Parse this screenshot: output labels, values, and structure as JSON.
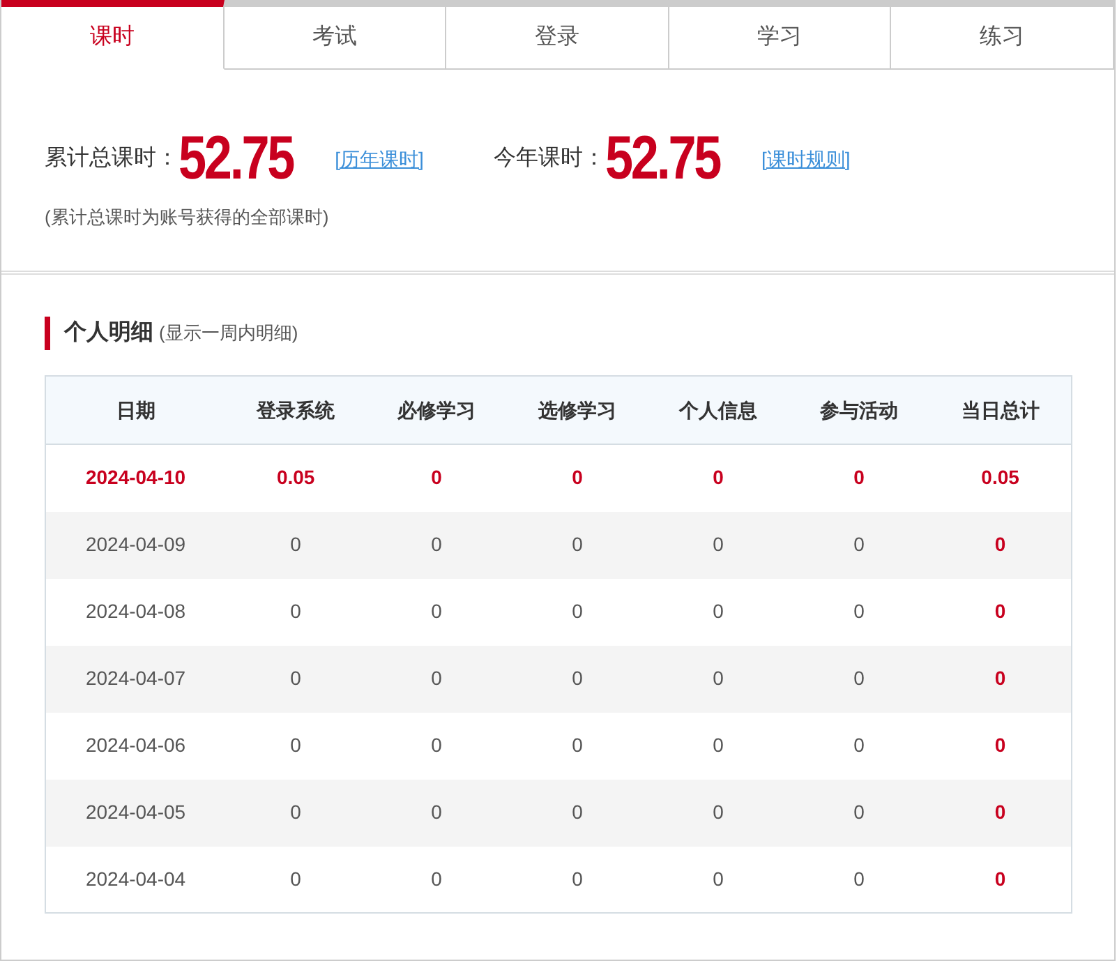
{
  "tabs": [
    {
      "label": "课时",
      "selected": true
    },
    {
      "label": "考试",
      "selected": false
    },
    {
      "label": "登录",
      "selected": false
    },
    {
      "label": "学习",
      "selected": false
    },
    {
      "label": "练习",
      "selected": false
    }
  ],
  "summary": {
    "stats": [
      {
        "label": "累计总课时：",
        "value": "52.75",
        "link": "[历年课时]"
      },
      {
        "label": "今年课时：",
        "value": "52.75",
        "link": "[课时规则]"
      }
    ],
    "note": "(累计总课时为账号获得的全部课时)"
  },
  "detail": {
    "title": "个人明细",
    "subtitle": "(显示一周内明细)",
    "table": {
      "columns": [
        "日期",
        "登录系统",
        "必修学习",
        "选修学习",
        "个人信息",
        "参与活动",
        "当日总计"
      ],
      "rows": [
        {
          "highlighted": true,
          "cells": [
            "2024-04-10",
            "0.05",
            "0",
            "0",
            "0",
            "0",
            "0.05"
          ]
        },
        {
          "highlighted": false,
          "cells": [
            "2024-04-09",
            "0",
            "0",
            "0",
            "0",
            "0",
            "0"
          ]
        },
        {
          "highlighted": false,
          "cells": [
            "2024-04-08",
            "0",
            "0",
            "0",
            "0",
            "0",
            "0"
          ]
        },
        {
          "highlighted": false,
          "cells": [
            "2024-04-07",
            "0",
            "0",
            "0",
            "0",
            "0",
            "0"
          ]
        },
        {
          "highlighted": false,
          "cells": [
            "2024-04-06",
            "0",
            "0",
            "0",
            "0",
            "0",
            "0"
          ]
        },
        {
          "highlighted": false,
          "cells": [
            "2024-04-05",
            "0",
            "0",
            "0",
            "0",
            "0",
            "0"
          ]
        },
        {
          "highlighted": false,
          "cells": [
            "2024-04-04",
            "0",
            "0",
            "0",
            "0",
            "0",
            "0"
          ]
        }
      ]
    }
  }
}
